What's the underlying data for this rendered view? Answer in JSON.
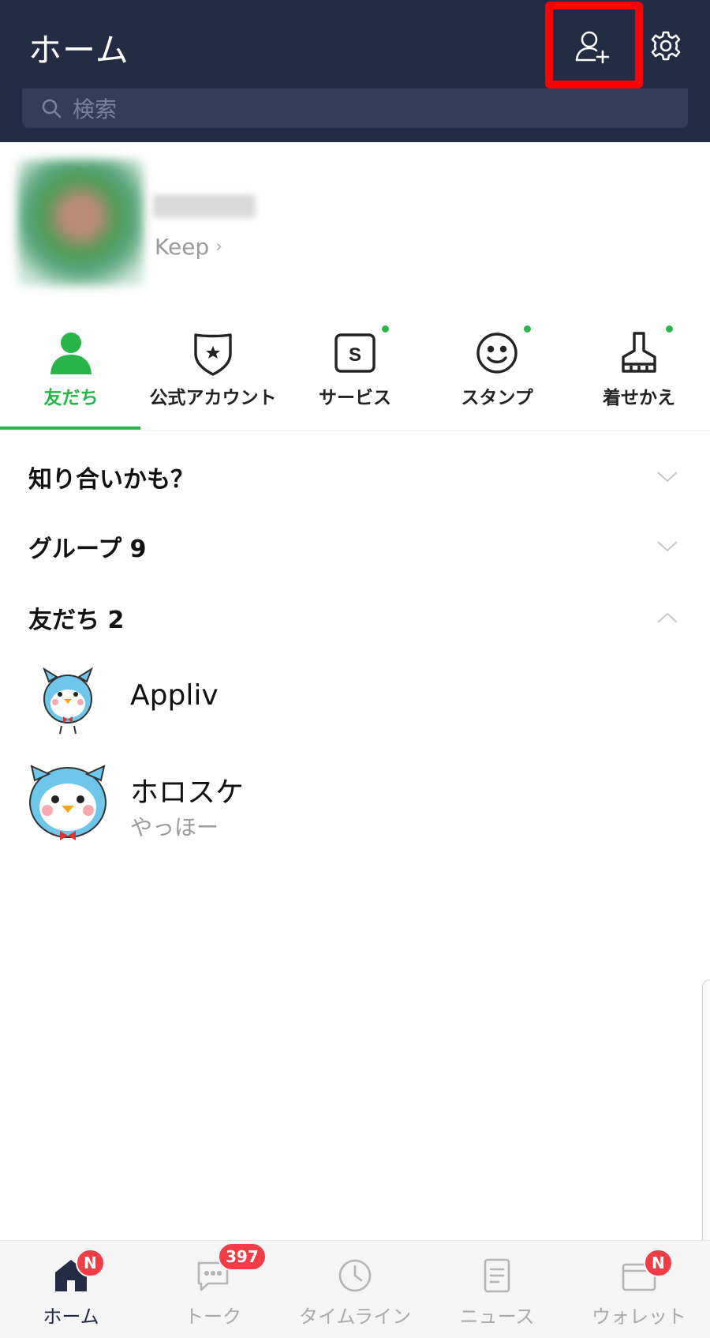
{
  "header": {
    "title": "ホーム",
    "add_friend_icon": "add-friend-icon",
    "settings_icon": "gear-icon",
    "search_placeholder": "検索",
    "highlight_color": "#ff0000",
    "background": "#232b45"
  },
  "profile": {
    "keep_label": "Keep"
  },
  "tabs": [
    {
      "label": "友だち",
      "icon": "person-icon",
      "active": true,
      "dot": false
    },
    {
      "label": "公式アカウント",
      "icon": "shield-star-icon",
      "active": false,
      "dot": false
    },
    {
      "label": "サービス",
      "icon": "service-s-icon",
      "active": false,
      "dot": true
    },
    {
      "label": "スタンプ",
      "icon": "smiley-icon",
      "active": false,
      "dot": true
    },
    {
      "label": "着せかえ",
      "icon": "brush-icon",
      "active": false,
      "dot": true
    }
  ],
  "sections": {
    "suggestions": {
      "title": "知り合いかも？",
      "expanded": false
    },
    "groups": {
      "title": "グループ 9",
      "expanded": false
    },
    "friends": {
      "title": "友だち 2",
      "expanded": true
    }
  },
  "friends": [
    {
      "name": "Appliv",
      "status": ""
    },
    {
      "name": "ホロスケ",
      "status": "やっほー"
    }
  ],
  "bottom_nav": [
    {
      "label": "ホーム",
      "icon": "home-icon",
      "badge": "N",
      "active": true
    },
    {
      "label": "トーク",
      "icon": "chat-bubble-icon",
      "badge": "397",
      "active": false
    },
    {
      "label": "タイムライン",
      "icon": "clock-icon",
      "badge": "",
      "active": false
    },
    {
      "label": "ニュース",
      "icon": "news-icon",
      "badge": "",
      "active": false
    },
    {
      "label": "ウォレット",
      "icon": "wallet-icon",
      "badge": "N",
      "active": false
    }
  ],
  "colors": {
    "accent_green": "#2ab54b",
    "badge_red": "#f23c46",
    "header_navy": "#232b45"
  }
}
